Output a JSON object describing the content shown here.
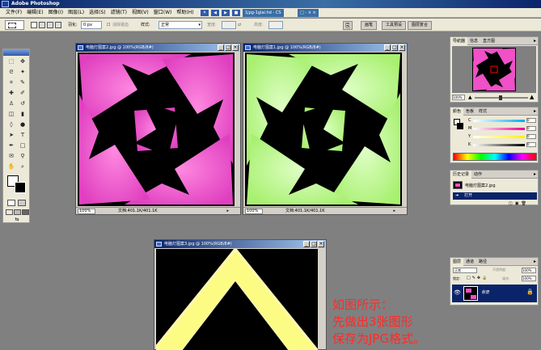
{
  "app": {
    "title": "Adobe Photoshop"
  },
  "menu": {
    "items": [
      "文件(F)",
      "编辑(E)",
      "图像(I)",
      "图层(L)",
      "选择(S)",
      "滤镜(T)",
      "视图(V)",
      "窗口(W)",
      "帮助(H)"
    ],
    "task_title": "1jpg-1glai.hd - CS",
    "task_buttons": "□ - × ×"
  },
  "options": {
    "feather_label": "羽化:",
    "feather_value": "0 px",
    "antialias_label": "消除锯齿",
    "style_label": "样式:",
    "style_value": "正常",
    "width_label": "宽度:",
    "height_label": "高度:",
    "tabs": [
      "画笔",
      "工具预设",
      "图层复合"
    ]
  },
  "docs": [
    {
      "title": "电脑灯图案2.jpg @ 100%(RGB/8#)",
      "zoom": "100%",
      "file_info": "文档:401.1K/401.1K"
    },
    {
      "title": "电脑灯图案1.jpg @ 100%(RGB/8#)",
      "zoom": "100%",
      "file_info": "文档:401.1K/401.1K"
    },
    {
      "title": "电脑灯图案3.jpg @ 100%(RGB/8#)"
    }
  ],
  "navigator": {
    "tabs": [
      "导航器",
      "信息",
      "直方图"
    ],
    "zoom": "100%"
  },
  "color": {
    "tabs": [
      "颜色",
      "色板",
      "样式"
    ],
    "channels": [
      "C",
      "M",
      "Y",
      "K"
    ],
    "values": [
      "0",
      "0",
      "0",
      "0"
    ]
  },
  "history": {
    "tabs": [
      "历史记录",
      "动作"
    ],
    "snapshot": "电脑灯图案2.jpg",
    "step": "打开"
  },
  "layers": {
    "tabs": [
      "图层",
      "通道",
      "路径"
    ],
    "mode": "正常",
    "opacity_label": "不透明度:",
    "opacity": "100%",
    "lock_label": "锁定:",
    "fill_label": "填充:",
    "fill": "100%",
    "layer_name": "背景"
  },
  "annotation": {
    "lines": [
      "如图所示：",
      "先做出3张图形",
      "保存为JPG格式。"
    ]
  },
  "colors": {
    "magenta": "#f050c8",
    "lime": "#b4f884",
    "yellow": "#fcfc84",
    "title_blue": "#0a246a",
    "annotation_red": "#ff2a2a"
  }
}
